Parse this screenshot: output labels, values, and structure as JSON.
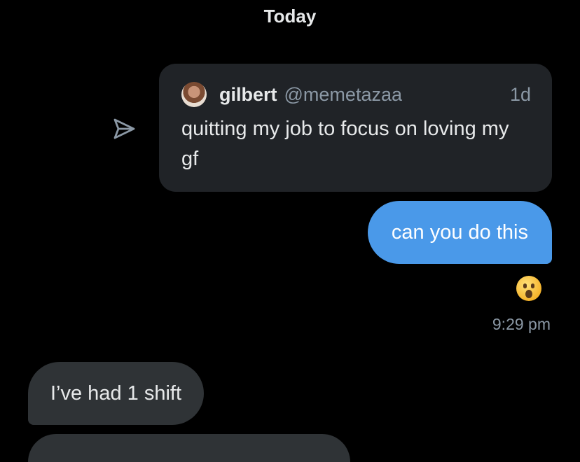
{
  "date_header": "Today",
  "quoted_post": {
    "author_name": "gilbert",
    "author_handle": "@memetazaa",
    "age": "1d",
    "text": "quitting my job to focus on loving my gf",
    "avatar_icon": "profile-photo"
  },
  "share_icon": "send-arrow-icon",
  "outgoing_message": {
    "text": "can you do this",
    "color": "#4a99e9"
  },
  "reaction": {
    "emoji": "😲",
    "icon": "hushed-face-emoji"
  },
  "timestamp": "9:29 pm",
  "incoming_message": {
    "text": "I’ve had 1 shift",
    "color": "#2f3336"
  }
}
